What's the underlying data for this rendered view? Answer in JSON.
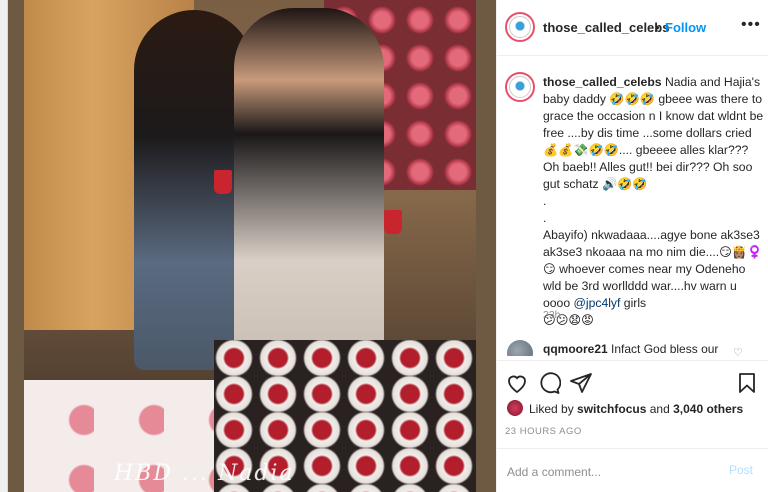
{
  "header": {
    "username": "those_called_celebs",
    "dot": "•",
    "follow_label": "Follow",
    "more_label": "•••"
  },
  "caption": {
    "username": "those_called_celebs",
    "text": " Nadia and Hajia's baby daddy 🤣🤣🤣 gbeee was there to grace the occasion n I know dat wldnt be free ....by dis time ...some dollars cried💰💰💸🤣🤣.... gbeeee alles klar??? Oh baeb!! Alles gut!! bei dir??? Oh soo gut schatz 🔊🤣🤣\n.\n.\nAbayifo) nkwadaaa....agye bone ak3se3 ak3se3 nkoaaa na mo nim die....😏👸🏽♀️😏 whoever comes near my Odeneho wld be 3rd worllddd war....hv warn u oooo ",
    "mention": "@jpc4lyf",
    "text_after": " girls\n😕😕😧😡",
    "time": "23h"
  },
  "comment": {
    "username": "qqmoore21",
    "text": " Infact God bless our",
    "heart": "♡"
  },
  "actions": {
    "like_icon": "heart-icon",
    "comment_icon": "comment-icon",
    "share_icon": "share-icon",
    "save_icon": "bookmark-icon"
  },
  "likes": {
    "prefix": "Liked by ",
    "user": "switchfocus",
    "middle": " and ",
    "count": "3,040 others"
  },
  "post_time": "23 HOURS AGO",
  "add_comment": {
    "placeholder": "Add a comment...",
    "post_label": "Post"
  },
  "photo_overlay_text": "HBD ... Nadia",
  "colors": {
    "follow_blue": "#0095f6",
    "post_disabled": "#b2dffc",
    "muted": "#8e8e8e",
    "story_ring": "#e94f6b"
  }
}
